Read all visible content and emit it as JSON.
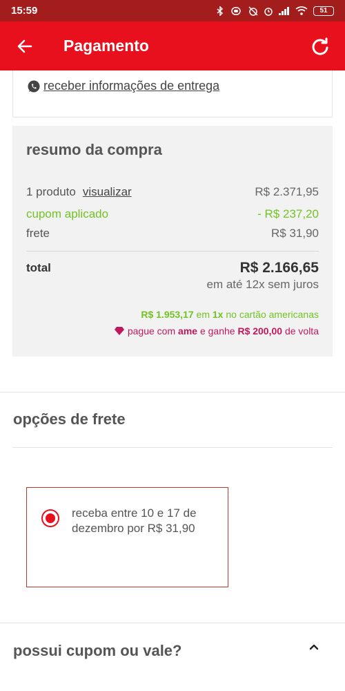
{
  "status_bar": {
    "time": "15:59",
    "battery": "51",
    "icons": [
      "bluetooth-icon",
      "vibrate-icon",
      "alarm-off-icon",
      "alarm-icon",
      "signal-icon",
      "wifi-icon",
      "battery-icon"
    ]
  },
  "app_bar": {
    "title": "Pagamento",
    "back_icon": "arrow-left-icon",
    "refresh_icon": "refresh-icon",
    "background": "#e8101d"
  },
  "delivery": {
    "link_label": "receber informações de entrega",
    "icon": "whatsapp-icon"
  },
  "summary": {
    "title": "resumo da compra",
    "product_count": "1 produto",
    "view_label": "visualizar",
    "product_price": "R$ 2.371,95",
    "coupon_label": "cupom aplicado",
    "coupon_value": "- R$ 237,20",
    "shipping_label": "frete",
    "shipping_value": "R$ 31,90",
    "total_label": "total",
    "total_value": "R$ 2.166,65",
    "installments": "em até 12x sem juros",
    "cash_price": "R$ 1.953,17",
    "cash_mid": "em",
    "cash_times": "1x",
    "cash_suffix": "no cartão americanas",
    "ame_prefix": "pague com",
    "ame_brand": "ame",
    "ame_mid": "e ganhe",
    "ame_cashback": "R$ 200,00",
    "ame_suffix": "de volta",
    "accent_green": "#71c322",
    "accent_pink": "#c2185b"
  },
  "shipping": {
    "title": "opções de frete",
    "option_text": "receba entre 10 e 17 de dezembro por R$ 31,90",
    "selected": true
  },
  "coupon": {
    "title": "possui cupom ou vale?",
    "expanded_icon": "chevron-up-icon"
  }
}
